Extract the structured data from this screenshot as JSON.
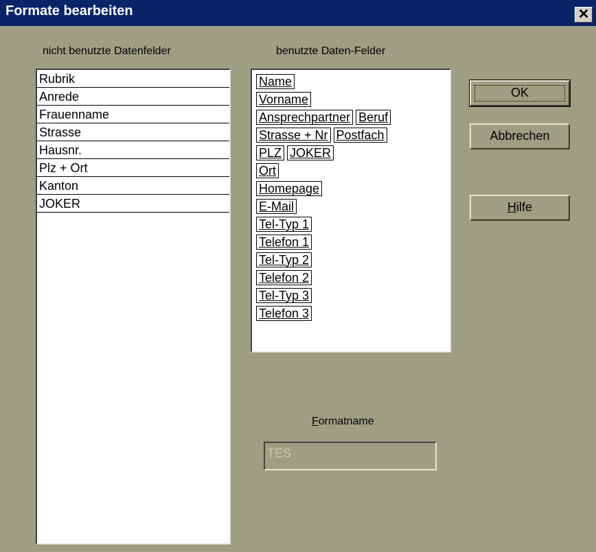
{
  "window": {
    "title": "Formate bearbeiten",
    "close_glyph": "✕"
  },
  "unused": {
    "label": "nicht benutzte Datenfelder",
    "items": [
      "Rubrik",
      "Anrede",
      "Frauenname",
      "Strasse",
      "Hausnr.",
      "Plz + Ort",
      "Kanton",
      "JOKER"
    ]
  },
  "used": {
    "label": "benutzte Daten-Felder",
    "rows": [
      [
        "Name"
      ],
      [
        "Vorname"
      ],
      [
        "Ansprechpartner",
        "Beruf"
      ],
      [
        "Strasse + Nr",
        "Postfach"
      ],
      [
        "PLZ",
        "JOKER"
      ],
      [
        "Ort"
      ],
      [
        "Homepage"
      ],
      [
        "E-Mail"
      ],
      [
        "Tel-Typ 1"
      ],
      [
        "Telefon 1"
      ],
      [
        "Tel-Typ 2"
      ],
      [
        "Telefon 2"
      ],
      [
        "Tel-Typ 3"
      ],
      [
        "Telefon 3"
      ]
    ]
  },
  "buttons": {
    "ok": "OK",
    "cancel": "Abbrechen",
    "help_first": "H",
    "help_rest": "ilfe"
  },
  "formatname": {
    "label_first": "F",
    "label_rest": "ormatname",
    "value": "TES"
  }
}
